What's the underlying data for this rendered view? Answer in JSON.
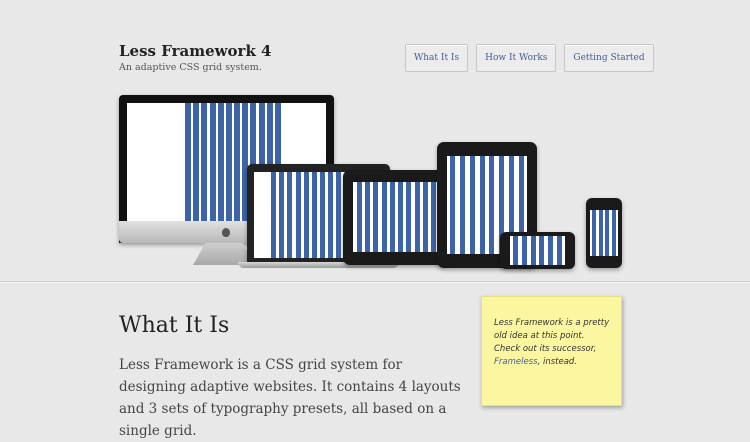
{
  "header": {
    "title": "Less Framework 4",
    "tagline": "An adaptive CSS grid system."
  },
  "nav": [
    {
      "label": "What It Is"
    },
    {
      "label": "How It Works"
    },
    {
      "label": "Getting Started"
    }
  ],
  "hero": {
    "image_alt": "Devices showing adaptive grid layouts",
    "colors": {
      "grid_bar": "#3d64a8",
      "device_frame": "#1a1a1a"
    }
  },
  "section": {
    "title": "What It Is",
    "text": "Less Framework is a CSS grid system for designing adaptive websites. It contains 4 layouts and 3 sets of typography presets, all based on a single grid."
  },
  "note": {
    "text_before": "Less Framework is a pretty old idea at this point. Check out its successor,",
    "link_label": "Frameless",
    "text_after": ", instead."
  }
}
